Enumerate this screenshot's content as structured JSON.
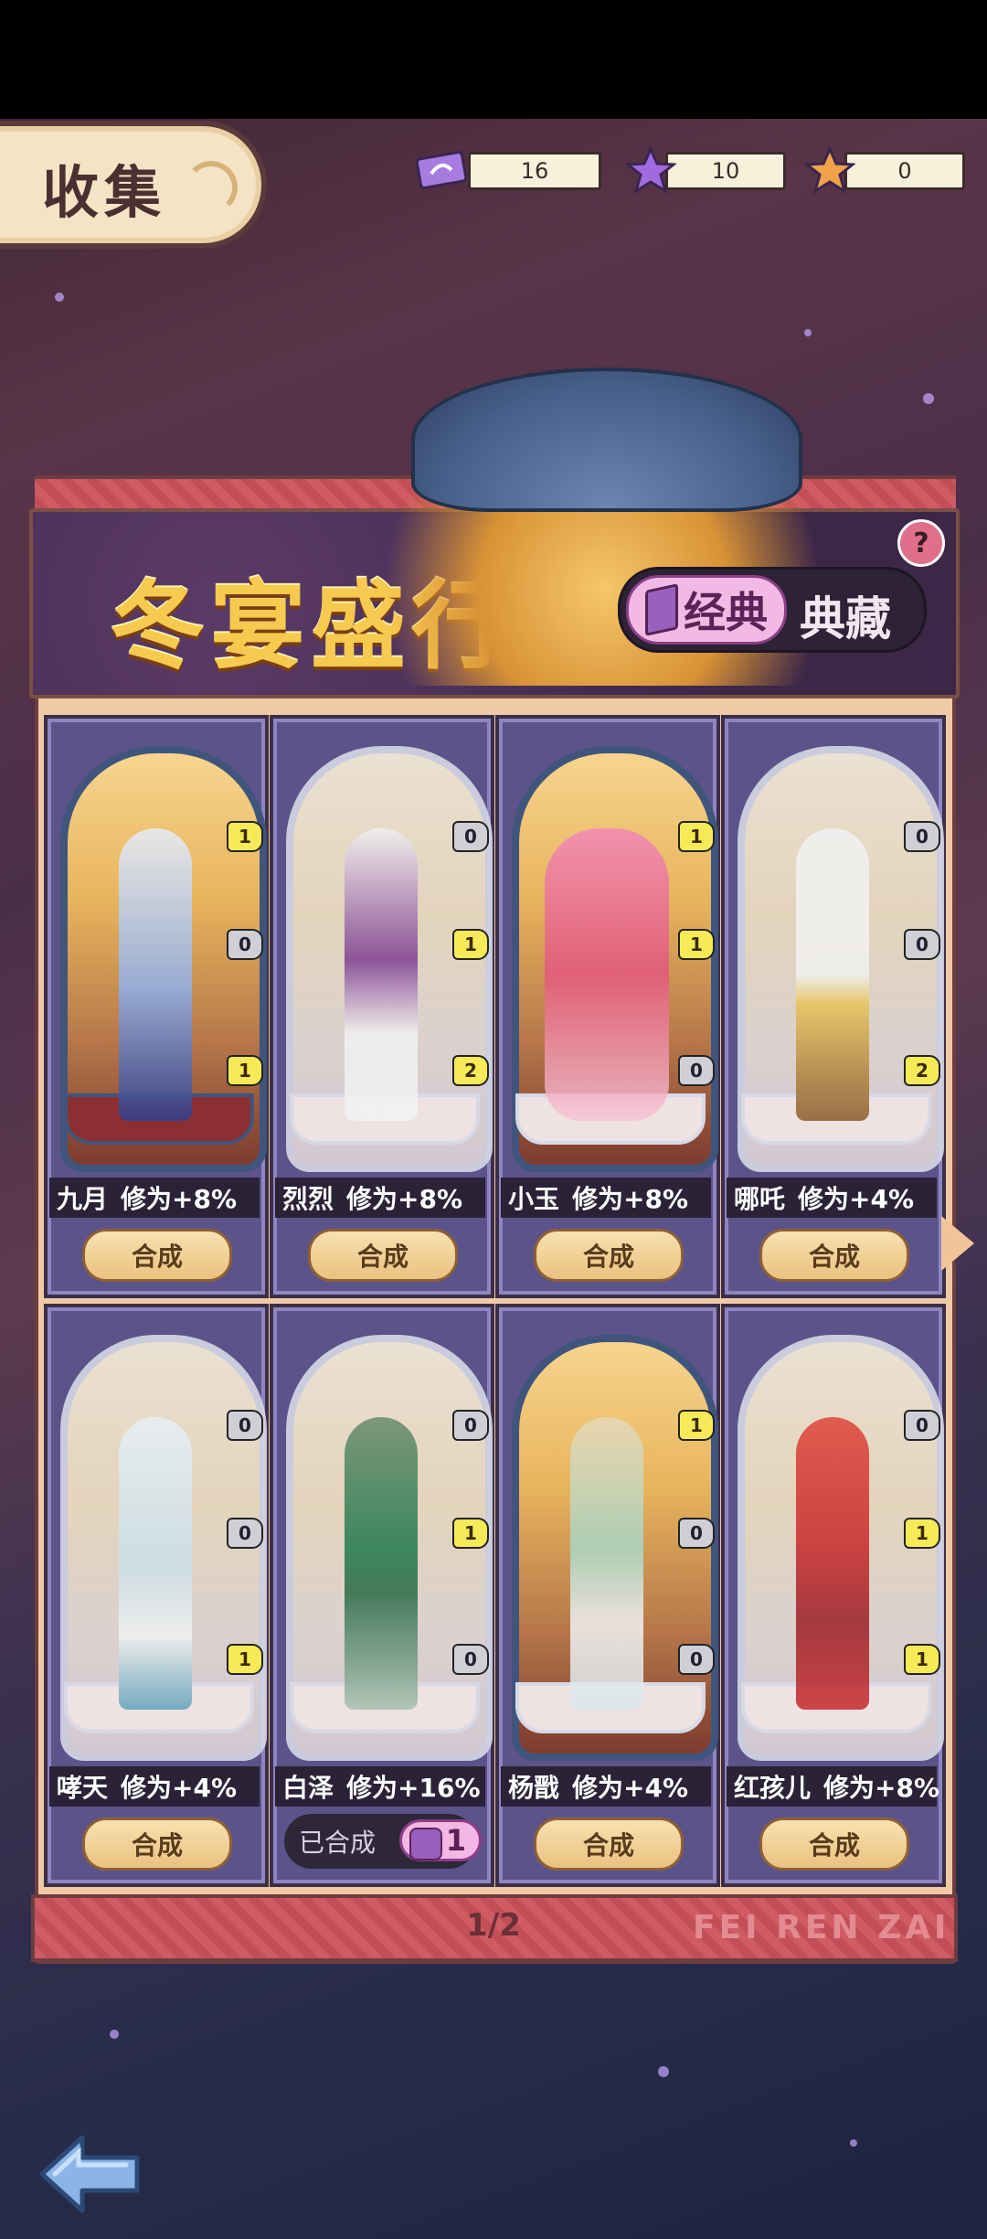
{
  "header": {
    "title": "收集"
  },
  "resources": [
    {
      "icon": "ticket-icon",
      "value": "16"
    },
    {
      "icon": "purple-star-icon",
      "value": "10"
    },
    {
      "icon": "orange-star-icon",
      "value": "0"
    }
  ],
  "banner": {
    "title": "冬宴盛行",
    "help": "?"
  },
  "toggle": {
    "active": "经典",
    "inactive": "典藏"
  },
  "cards": [
    {
      "name": "九月",
      "bonus": "修为+8%",
      "action": "合成",
      "badges": [
        "1",
        "0",
        "1"
      ]
    },
    {
      "name": "烈烈",
      "bonus": "修为+8%",
      "action": "合成",
      "badges": [
        "0",
        "1",
        "2"
      ]
    },
    {
      "name": "小玉",
      "bonus": "修为+8%",
      "action": "合成",
      "badges": [
        "1",
        "1",
        "0"
      ]
    },
    {
      "name": "哪吒",
      "bonus": "修为+4%",
      "action": "合成",
      "badges": [
        "0",
        "0",
        "2"
      ]
    },
    {
      "name": "哮天",
      "bonus": "修为+4%",
      "action": "合成",
      "badges": [
        "0",
        "0",
        "1"
      ]
    },
    {
      "name": "白泽",
      "bonus": "修为+16%",
      "composed_label": "已合成",
      "composed_count": "1",
      "badges": [
        "0",
        "1",
        "0"
      ]
    },
    {
      "name": "杨戬",
      "bonus": "修为+4%",
      "action": "合成",
      "badges": [
        "1",
        "0",
        "0"
      ]
    },
    {
      "name": "红孩儿",
      "bonus": "修为+8%",
      "action": "合成",
      "badges": [
        "0",
        "1",
        "1"
      ]
    }
  ],
  "pagination": {
    "text": "1/2"
  },
  "watermark": "FEI REN ZAI",
  "colors": {
    "accent_gold": "#f6c94f",
    "card_bg": "#5b5389",
    "button_bg": "#eac27f",
    "toggle_pink": "#f1b9e3"
  }
}
